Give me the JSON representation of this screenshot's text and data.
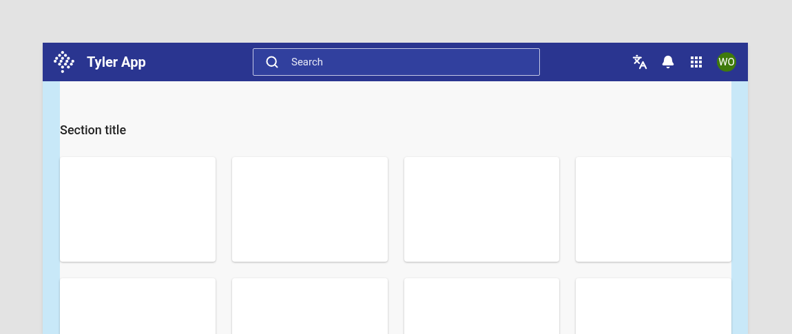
{
  "app_bar": {
    "title": "Tyler App",
    "search": {
      "placeholder": "Search"
    },
    "avatar": {
      "initials": "WO",
      "color": "#3f7a0c"
    }
  },
  "section": {
    "title": "Section title"
  }
}
